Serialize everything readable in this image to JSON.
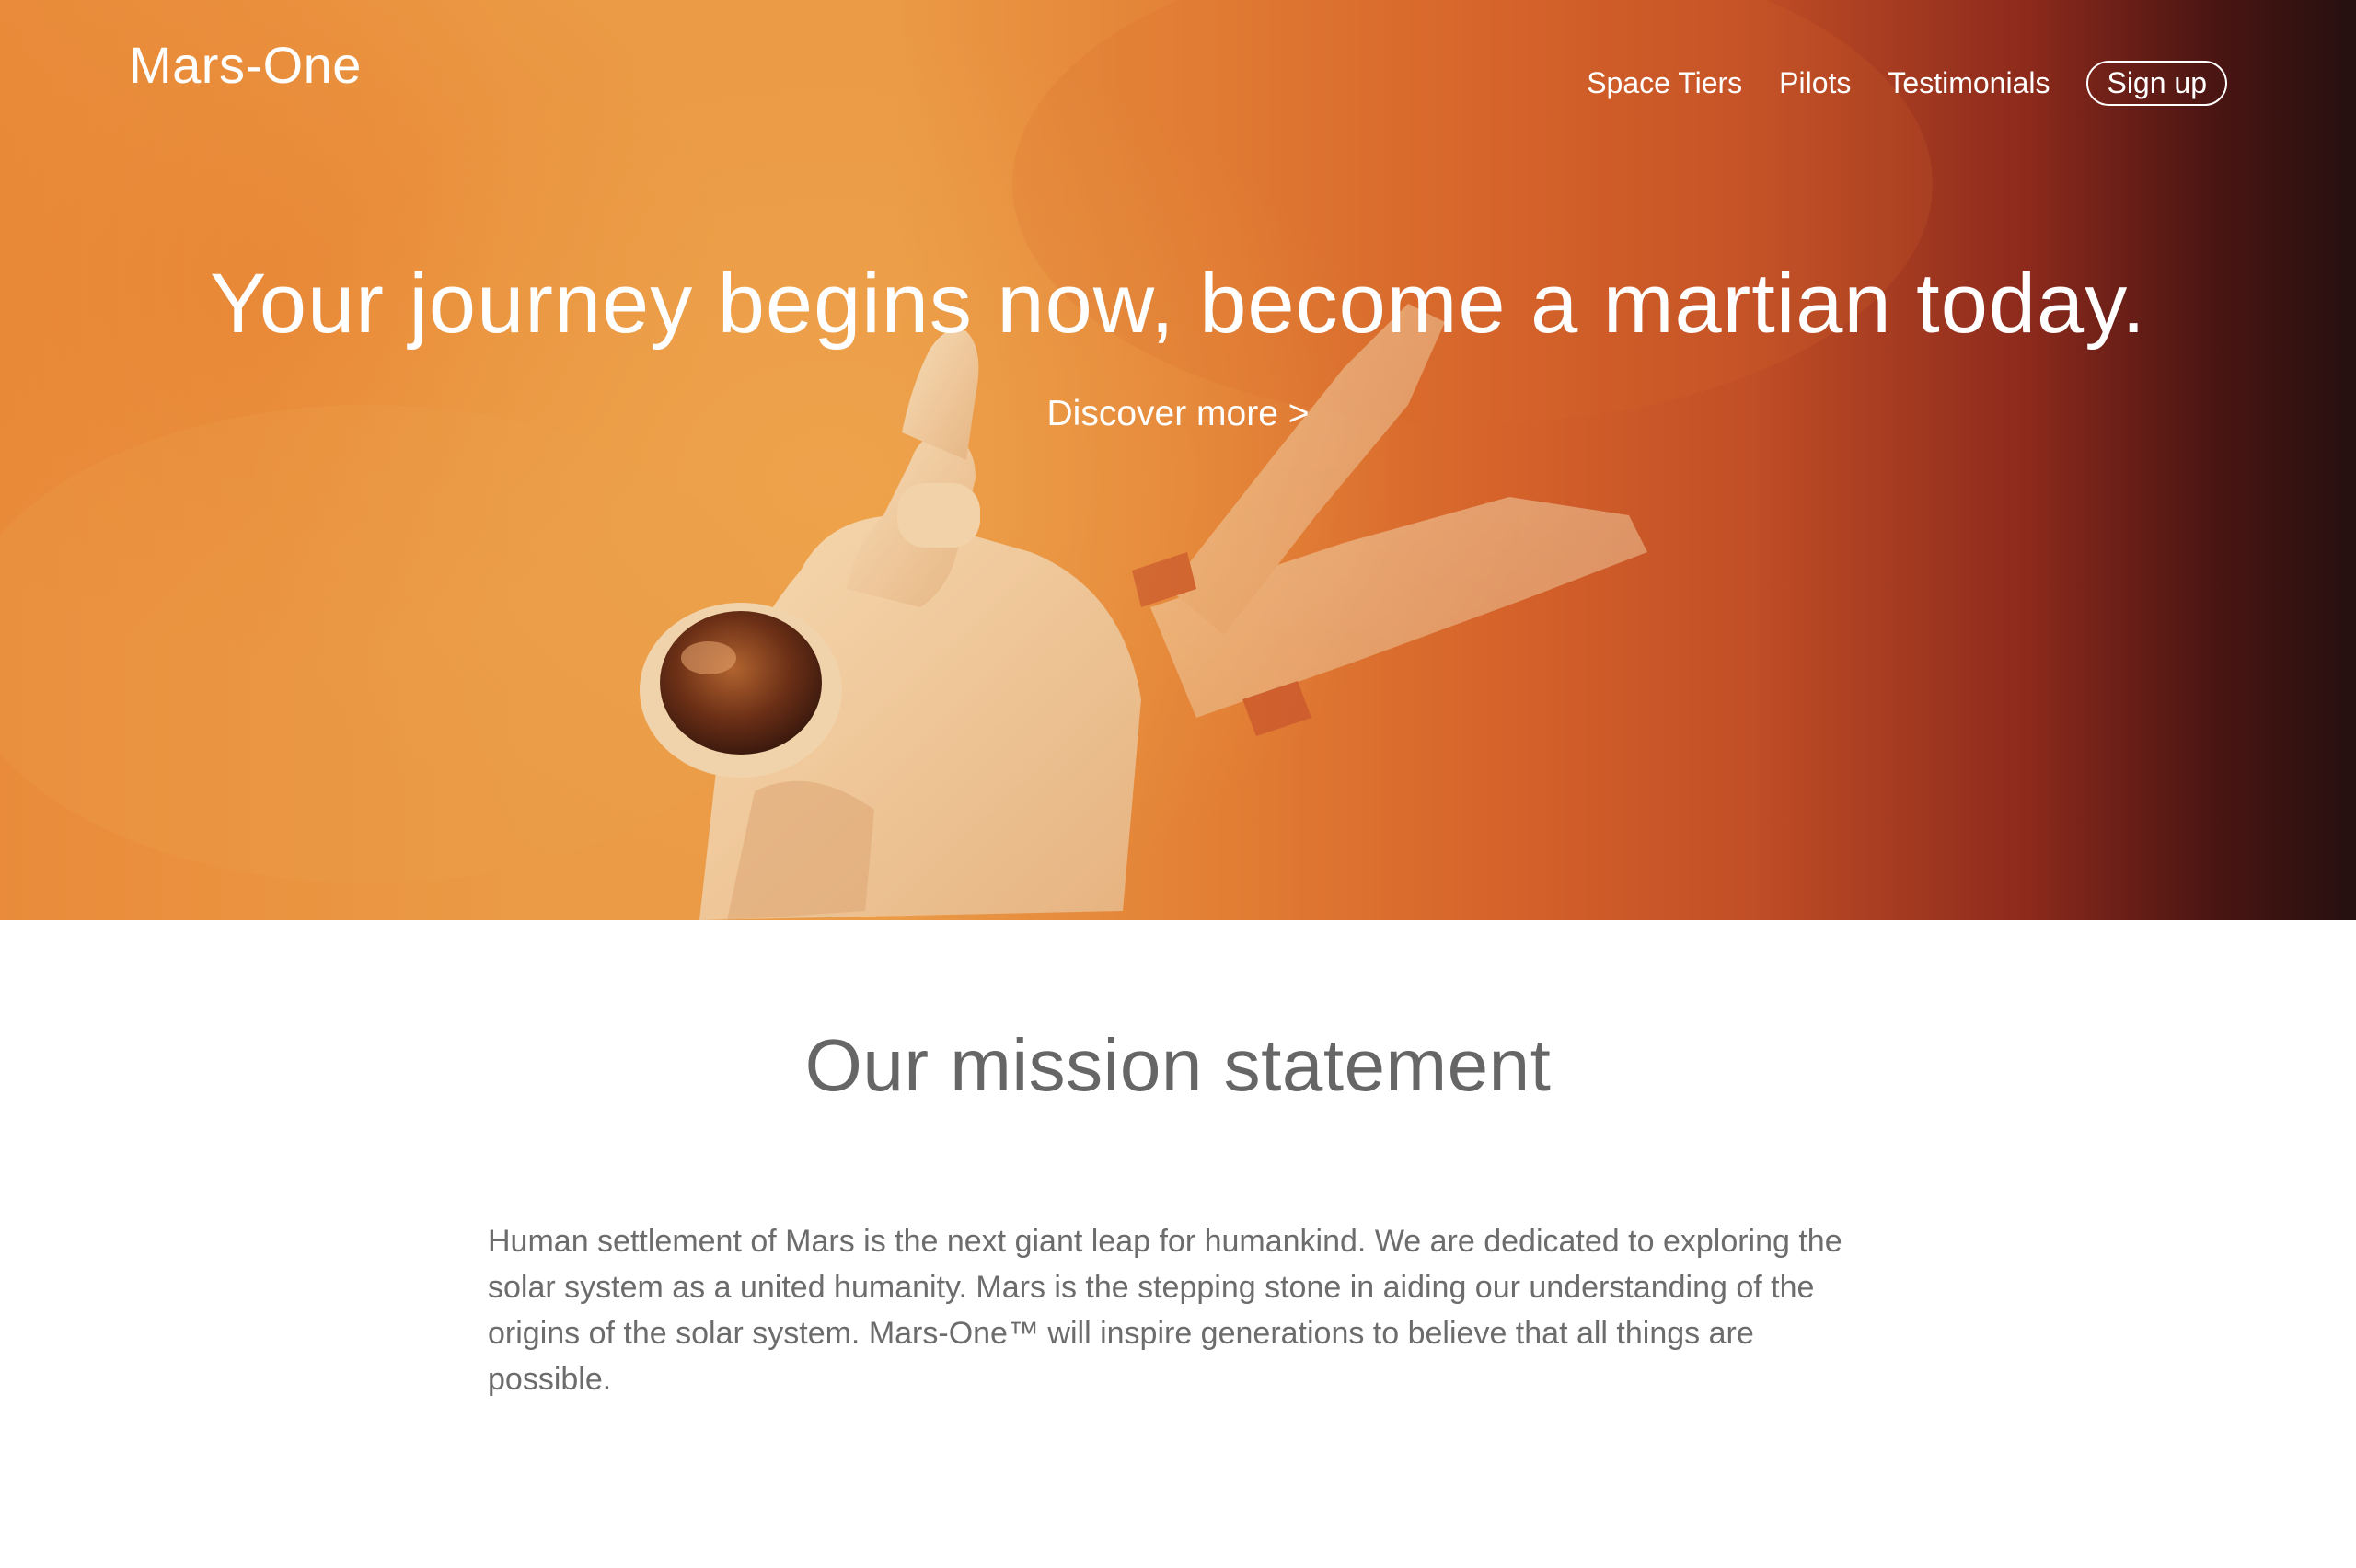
{
  "header": {
    "brand": "Mars-One",
    "nav": {
      "space_tiers": "Space Tiers",
      "pilots": "Pilots",
      "testimonials": "Testimonials",
      "sign_up": "Sign up"
    }
  },
  "hero": {
    "headline": "Your journey begins now, become a martian today.",
    "cta": "Discover more >",
    "image": "astronaut-painting"
  },
  "mission": {
    "title": "Our mission statement",
    "body": "Human settlement of Mars is the next giant leap for humankind. We are dedicated to exploring the solar system as a united humanity. Mars is the stepping stone in aiding our understanding of the origins of the solar system. Mars-One™ will inspire generations to believe that all things are possible."
  },
  "colors": {
    "hero_orange": "#eb9a45",
    "hero_dark": "#251010",
    "text_gray": "#6c6c6c",
    "white": "#ffffff"
  }
}
